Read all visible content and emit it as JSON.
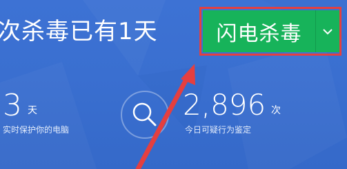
{
  "header": {
    "headline": "次杀毒已有1天"
  },
  "scan_button": {
    "label": "闪电杀毒",
    "dropdown_icon": "chevron-down-icon",
    "color": "#17b35a"
  },
  "highlight": {
    "color": "#e53f3f"
  },
  "stats": {
    "protection": {
      "value": "3",
      "unit": "天",
      "caption": "实时保护你的电脑"
    },
    "suspicious": {
      "value": "2,896",
      "unit": "次",
      "caption": "今日可疑行为鉴定"
    }
  },
  "icons": {
    "center": "magnifier-icon",
    "annotation": "red-arrow"
  },
  "colors": {
    "background": "#3a6fd0",
    "text": "#ffffff"
  }
}
